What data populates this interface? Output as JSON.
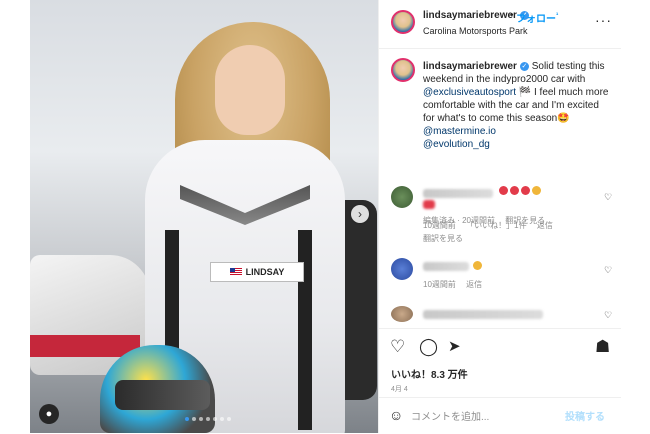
{
  "post": {
    "username": "lindsaymariebrewer",
    "follow_label": "フォロー",
    "follow_suffix": "¹",
    "separator": "•",
    "location": "Carolina Motorsports Park",
    "more_icon": "more-dots-icon",
    "photo": {
      "belt_name": "LINDSAY",
      "slide_count": 7,
      "active_slide": 1
    }
  },
  "caption": {
    "username": "lindsaymariebrewer",
    "text_1": " Solid testing this weekend in the indypro2000 car with ",
    "mention_1": "@exclusiveautosport",
    "text_2": " 🏁 I feel much more comfortable with the car and I'm excited for what's to come this season🤩 ",
    "mention_2": "@mastermine.io",
    "mention_3": "@evolution_dg",
    "edited": "編集済み · 20週間前",
    "see_translation": "翻訳を見る"
  },
  "comments": [
    {
      "time": "10週間前",
      "likes": "「いいね！」1件",
      "reply": "返信",
      "see_translation": "翻訳を見る"
    },
    {
      "time": "10週間前",
      "reply": "返信"
    }
  ],
  "stats": {
    "likes": "いいね！8.3 万件",
    "date": "4月 4"
  },
  "composer": {
    "placeholder": "コメントを追加...",
    "post_label": "投稿する"
  },
  "colors": {
    "link": "#00376b",
    "follow": "#0095f6",
    "muted": "#8e8e8e"
  }
}
